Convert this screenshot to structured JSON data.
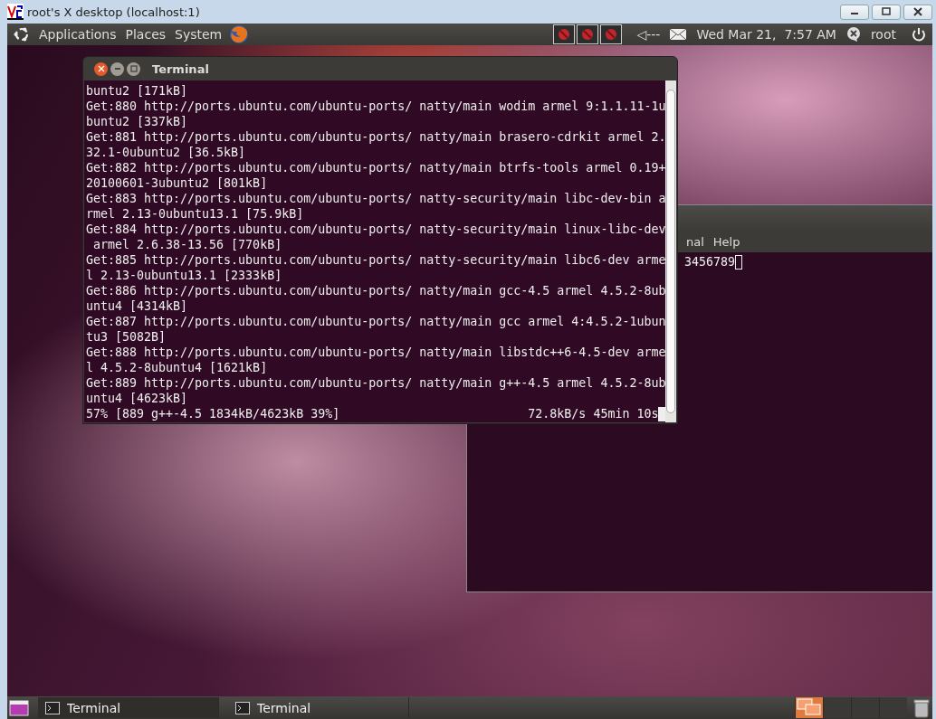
{
  "window": {
    "title": "root's X desktop (localhost:1)"
  },
  "top_panel": {
    "menus": [
      "Applications",
      "Places",
      "System"
    ],
    "volume_text": "◁---",
    "clock": "Wed Mar 21,  7:57 AM",
    "user": "root"
  },
  "terminal_front": {
    "title": "Terminal",
    "lines": [
      "buntu2 [171kB]",
      "Get:880 http://ports.ubuntu.com/ubuntu-ports/ natty/main wodim armel 9:1.1.11-1u",
      "buntu2 [337kB]",
      "Get:881 http://ports.ubuntu.com/ubuntu-ports/ natty/main brasero-cdrkit armel 2.",
      "32.1-0ubuntu2 [36.5kB]",
      "Get:882 http://ports.ubuntu.com/ubuntu-ports/ natty/main btrfs-tools armel 0.19+",
      "20100601-3ubuntu2 [801kB]",
      "Get:883 http://ports.ubuntu.com/ubuntu-ports/ natty-security/main libc-dev-bin a",
      "rmel 2.13-0ubuntu13.1 [75.9kB]",
      "Get:884 http://ports.ubuntu.com/ubuntu-ports/ natty-security/main linux-libc-dev",
      " armel 2.6.38-13.56 [770kB]",
      "Get:885 http://ports.ubuntu.com/ubuntu-ports/ natty-security/main libc6-dev arme",
      "l 2.13-0ubuntu13.1 [2333kB]",
      "Get:886 http://ports.ubuntu.com/ubuntu-ports/ natty/main gcc-4.5 armel 4.5.2-8ub",
      "untu4 [4314kB]",
      "Get:887 http://ports.ubuntu.com/ubuntu-ports/ natty/main gcc armel 4:4.5.2-1ubun",
      "tu3 [5082B]",
      "Get:888 http://ports.ubuntu.com/ubuntu-ports/ natty/main libstdc++6-4.5-dev arme",
      "l 4.5.2-8ubuntu4 [1621kB]",
      "Get:889 http://ports.ubuntu.com/ubuntu-ports/ natty/main g++-4.5 armel 4.5.2-8ub",
      "untu4 [4623kB]"
    ],
    "progress": "57% [889 g++-4.5 1834kB/4623kB 39%]",
    "speed": "72.8kB/s 45min 10s"
  },
  "terminal_back": {
    "menus": [
      "nal",
      "Help"
    ],
    "line": "3456789"
  },
  "taskbar": {
    "tasks": [
      {
        "label": "Terminal",
        "selected": true
      },
      {
        "label": "Terminal",
        "selected": false
      }
    ],
    "workspaces": [
      {
        "selected": true
      },
      {
        "selected": false
      },
      {
        "selected": false
      },
      {
        "selected": false
      }
    ]
  }
}
